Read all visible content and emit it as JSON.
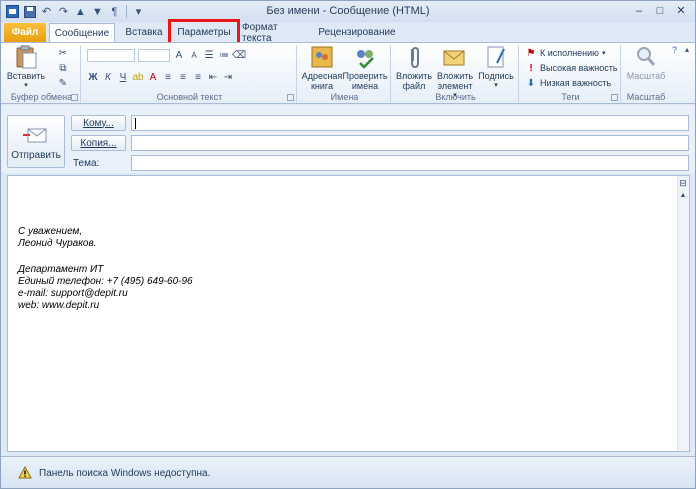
{
  "window": {
    "title": "Без имени - Сообщение (HTML)"
  },
  "quick_access": [
    "save-icon",
    "undo-icon",
    "redo-icon",
    "up-icon",
    "down-icon",
    "format-icon",
    "customize-icon"
  ],
  "tabs": [
    {
      "label": "Файл"
    },
    {
      "label": "Сообщение"
    },
    {
      "label": "Вставка"
    },
    {
      "label": "Параметры"
    },
    {
      "label": "Формат текста"
    },
    {
      "label": "Рецензирование"
    }
  ],
  "ribbon": {
    "clipboard": {
      "label": "Буфер обмена",
      "paste": "Вставить"
    },
    "basic_text": {
      "label": "Основной текст"
    },
    "names": {
      "label": "Имена",
      "address_book": "Адресная книга",
      "check_names": "Проверить имена"
    },
    "include": {
      "label": "Включить",
      "attach_file": "Вложить файл",
      "attach_item": "Вложить элемент",
      "signature": "Подпись"
    },
    "tags": {
      "label": "Теги",
      "follow_up": "К исполнению",
      "high_importance": "Высокая важность",
      "low_importance": "Низкая важность"
    },
    "zoom": {
      "label": "Масштаб",
      "zoom": "Масштаб"
    }
  },
  "header": {
    "send": "Отправить",
    "to": "Кому...",
    "cc": "Копия...",
    "subject": "Тема:",
    "to_value": "",
    "cc_value": "",
    "subject_value": ""
  },
  "signature": {
    "line1": "С уважением,",
    "line2": "Леонид Чураков.",
    "line3": "Департамент ИТ",
    "line4": "Единый телефон: +7 (495) 649-60-96",
    "line5": "e-mail: support@depit.ru",
    "line6": "web: www.depit.ru"
  },
  "status": {
    "text": "Панель поиска Windows недоступна."
  },
  "colors": {
    "highlight": "#e8161b",
    "file_tab": "#f0ac1e"
  }
}
